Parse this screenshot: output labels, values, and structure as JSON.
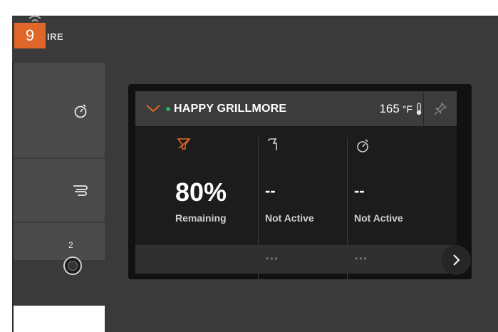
{
  "badge": {
    "number": "9"
  },
  "brand": {
    "partial_label": "IRE",
    "accent_color": "#e0662a"
  },
  "sidebar": {
    "items": [
      {
        "icon": "stopwatch-icon"
      },
      {
        "icon": "smoke-icon"
      },
      {
        "icon": "knob-icon",
        "label": "2"
      }
    ]
  },
  "grill_card": {
    "name": "HAPPY GRILLMORE",
    "status_color": "#29b36a",
    "temperature": "165",
    "temperature_unit": "°F",
    "columns": [
      {
        "icon": "pellet-hopper-icon",
        "value": "80%",
        "label": "Remaining",
        "more": ""
      },
      {
        "icon": "probe-icon",
        "value": "--",
        "label": "Not Active",
        "more": "•••"
      },
      {
        "icon": "timer-icon",
        "value": "--",
        "label": "Not Active",
        "more": "•••"
      }
    ]
  }
}
